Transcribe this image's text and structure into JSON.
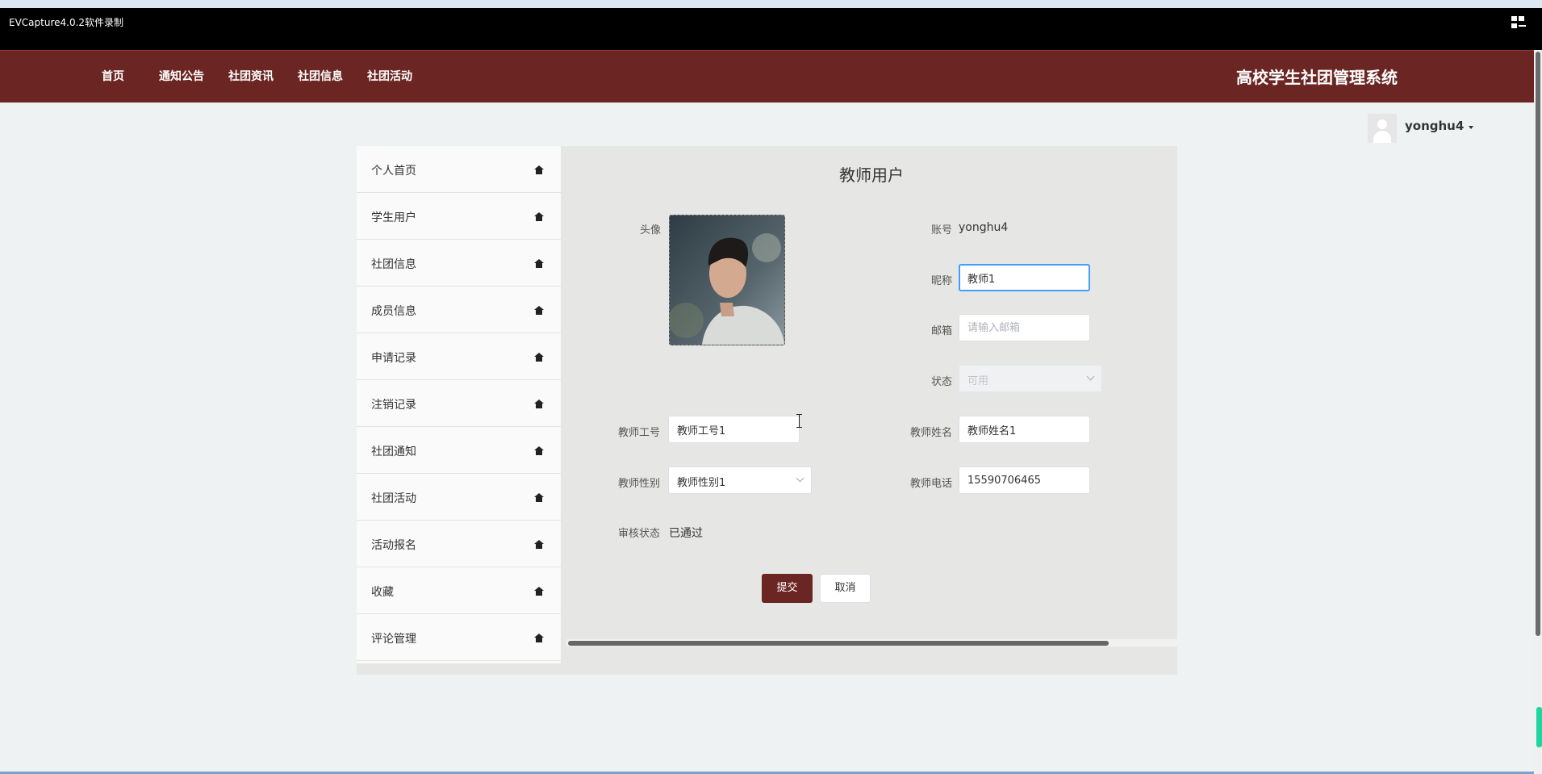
{
  "capture_app": {
    "title": "EVCapture4.0.2软件录制",
    "icon": "layout-icon"
  },
  "nav": {
    "items": [
      "首页",
      "通知公告",
      "社团资讯",
      "社团信息",
      "社团活动"
    ],
    "brand": "高校学生社团管理系统",
    "color": "#6b2623"
  },
  "user": {
    "name": "yonghu4",
    "avatar_icon": "user-avatar-icon",
    "dropdown_icon": "caret-down-icon"
  },
  "sidebar": {
    "items": [
      {
        "label": "个人首页",
        "icon": "home-icon"
      },
      {
        "label": "学生用户",
        "icon": "home-icon"
      },
      {
        "label": "社团信息",
        "icon": "home-icon"
      },
      {
        "label": "成员信息",
        "icon": "home-icon"
      },
      {
        "label": "申请记录",
        "icon": "home-icon"
      },
      {
        "label": "注销记录",
        "icon": "home-icon"
      },
      {
        "label": "社团通知",
        "icon": "home-icon"
      },
      {
        "label": "社团活动",
        "icon": "home-icon"
      },
      {
        "label": "活动报名",
        "icon": "home-icon"
      },
      {
        "label": "收藏",
        "icon": "home-icon"
      },
      {
        "label": "评论管理",
        "icon": "home-icon"
      }
    ]
  },
  "form": {
    "title": "教师用户",
    "avatar_label": "头像",
    "account_label": "账号",
    "account_value": "yonghu4",
    "nickname_label": "昵称",
    "nickname_value": "教师1",
    "email_label": "邮箱",
    "email_placeholder": "请输入邮箱",
    "status_label": "状态",
    "status_value": "可用",
    "teacher_no_label": "教师工号",
    "teacher_no_value": "教师工号1",
    "teacher_name_label": "教师姓名",
    "teacher_name_value": "教师姓名1",
    "teacher_gender_label": "教师性别",
    "teacher_gender_value": "教师性别1",
    "teacher_phone_label": "教师电话",
    "teacher_phone_value": "15590706465",
    "review_label": "审核状态",
    "review_value": "已通过",
    "submit_label": "提交",
    "cancel_label": "取消"
  }
}
